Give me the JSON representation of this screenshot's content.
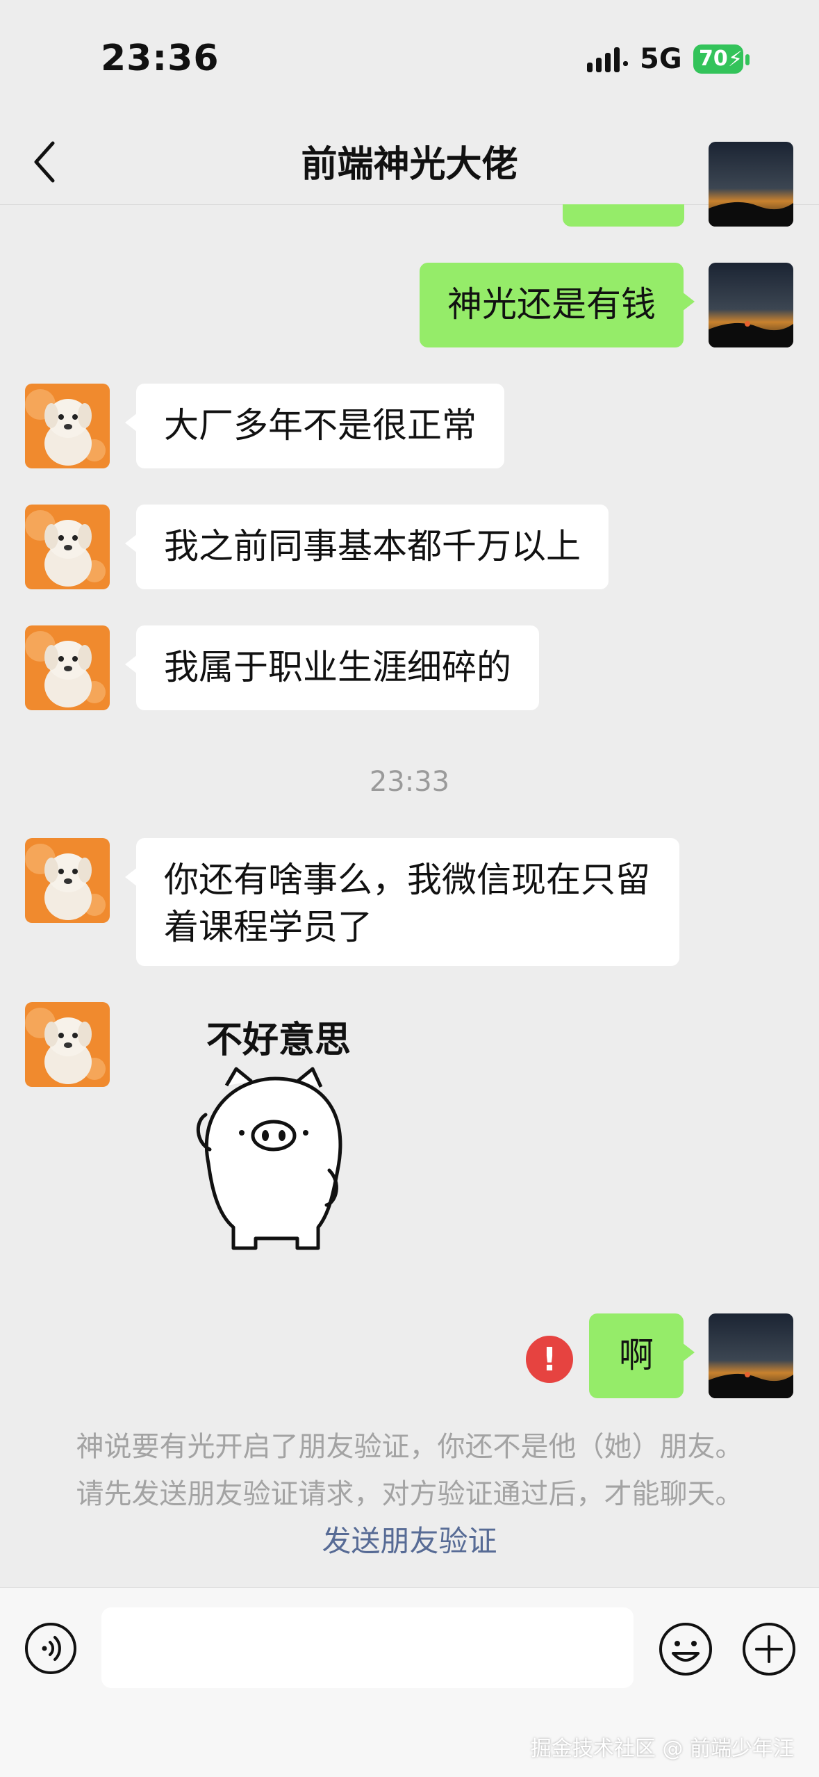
{
  "status_bar": {
    "time": "23:36",
    "network": "5G",
    "battery_level": "70"
  },
  "header": {
    "title": "前端神光大佬"
  },
  "messages": [
    {
      "from": "me",
      "text": "神光还是有钱"
    },
    {
      "from": "contact",
      "text": "大厂多年不是很正常"
    },
    {
      "from": "contact",
      "text": "我之前同事基本都千万以上"
    },
    {
      "from": "contact",
      "text": "我属于职业生涯细碎的"
    },
    {
      "from": "timestamp",
      "text": "23:33"
    },
    {
      "from": "contact",
      "text": "你还有啥事么，我微信现在只留着课程学员了"
    },
    {
      "from": "contact",
      "sticker_caption": "不好意思"
    },
    {
      "from": "me",
      "text": "啊",
      "status": "failed"
    }
  ],
  "notice": {
    "line1": "神说要有光开启了朋友验证，你还不是他（她）朋友。",
    "line2": "请先发送朋友验证请求，对方验证通过后，才能聊天。",
    "link": "发送朋友验证"
  },
  "input": {
    "placeholder": ""
  },
  "watermark": "掘金技术社区 @ 前端少年汪",
  "colors": {
    "background": "#ededed",
    "bubble_me": "#95ec69",
    "bubble_contact": "#ffffff",
    "error": "#e64340",
    "link": "#576b95",
    "battery": "#33c35a"
  },
  "icons": [
    "back-arrow-icon",
    "more-icon",
    "signal-icon",
    "battery-icon",
    "voice-icon",
    "emoji-icon",
    "plus-icon",
    "error-icon",
    "pig-sticker"
  ]
}
